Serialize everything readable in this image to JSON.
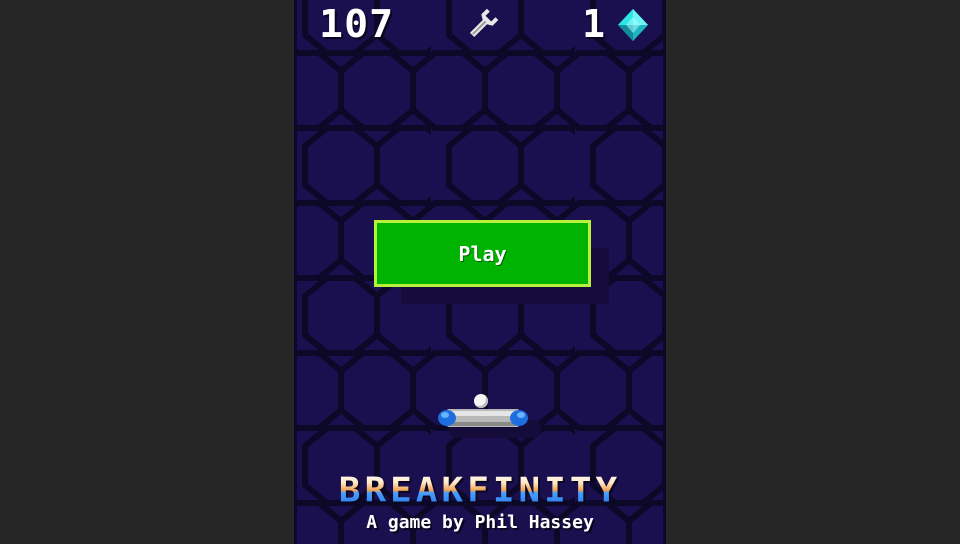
{
  "hud": {
    "score": "107",
    "gems": "1",
    "settings_icon": "wrench-icon",
    "gem_icon": "diamond-gem-icon"
  },
  "menu": {
    "play_label": "Play"
  },
  "title": {
    "logo_text": "BREAKFINITY",
    "credit": "A game by Phil Hassey"
  },
  "colors": {
    "background": "#1a1050",
    "hex_lines": "#0c0828",
    "play_fill": "#00b300",
    "play_border": "#b6f23a",
    "gem": "#2ee6e6"
  }
}
